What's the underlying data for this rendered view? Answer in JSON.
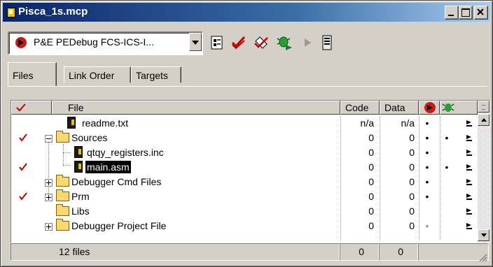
{
  "window": {
    "title": "Pisca_1s.mcp"
  },
  "toolbar": {
    "target": "P&E PEDebug FCS-ICS-I...",
    "icons": [
      "target-settings-icon",
      "make-icon",
      "synchronize-icon",
      "debug-icon",
      "run-icon",
      "project-inspector-icon"
    ]
  },
  "tabs": [
    {
      "label": "Files",
      "active": true
    },
    {
      "label": "Link Order",
      "active": false
    },
    {
      "label": "Targets",
      "active": false
    }
  ],
  "columns": {
    "check": "checkmark-icon",
    "file": "File",
    "code": "Code",
    "data": "Data",
    "debug": "debug-target-icon",
    "target": "bug-icon"
  },
  "rows": [
    {
      "check": false,
      "expander": "",
      "level": 0,
      "icon": "file",
      "name": "readme.txt",
      "code": "n/a",
      "data": "n/a",
      "debug_dot": "black",
      "target_dot": false
    },
    {
      "check": true,
      "expander": "minus",
      "level": 0,
      "icon": "folder",
      "name": "Sources",
      "code": "0",
      "data": "0",
      "debug_dot": "black",
      "target_dot": true
    },
    {
      "check": false,
      "expander": "",
      "level": 1,
      "icon": "file",
      "name": "qtqy_registers.inc",
      "code": "0",
      "data": "0",
      "debug_dot": "black",
      "target_dot": false
    },
    {
      "check": true,
      "expander": "",
      "level": 1,
      "icon": "file",
      "name": "main.asm",
      "code": "0",
      "data": "0",
      "debug_dot": "black",
      "target_dot": true,
      "selected": true
    },
    {
      "check": false,
      "expander": "plus",
      "level": 0,
      "icon": "folder",
      "name": "Debugger Cmd Files",
      "code": "0",
      "data": "0",
      "debug_dot": "black",
      "target_dot": false
    },
    {
      "check": true,
      "expander": "plus",
      "level": 0,
      "icon": "folder",
      "name": "Prm",
      "code": "0",
      "data": "0",
      "debug_dot": "black",
      "target_dot": false
    },
    {
      "check": false,
      "expander": "",
      "level": 0,
      "icon": "folder",
      "name": "Libs",
      "code": "0",
      "data": "0",
      "debug_dot": "none",
      "target_dot": false
    },
    {
      "check": false,
      "expander": "plus",
      "level": 0,
      "icon": "folder",
      "name": "Debugger Project File",
      "code": "0",
      "data": "0",
      "debug_dot": "grey",
      "target_dot": false
    }
  ],
  "status": {
    "files": "12 files",
    "code_total": "0",
    "data_total": "0"
  }
}
